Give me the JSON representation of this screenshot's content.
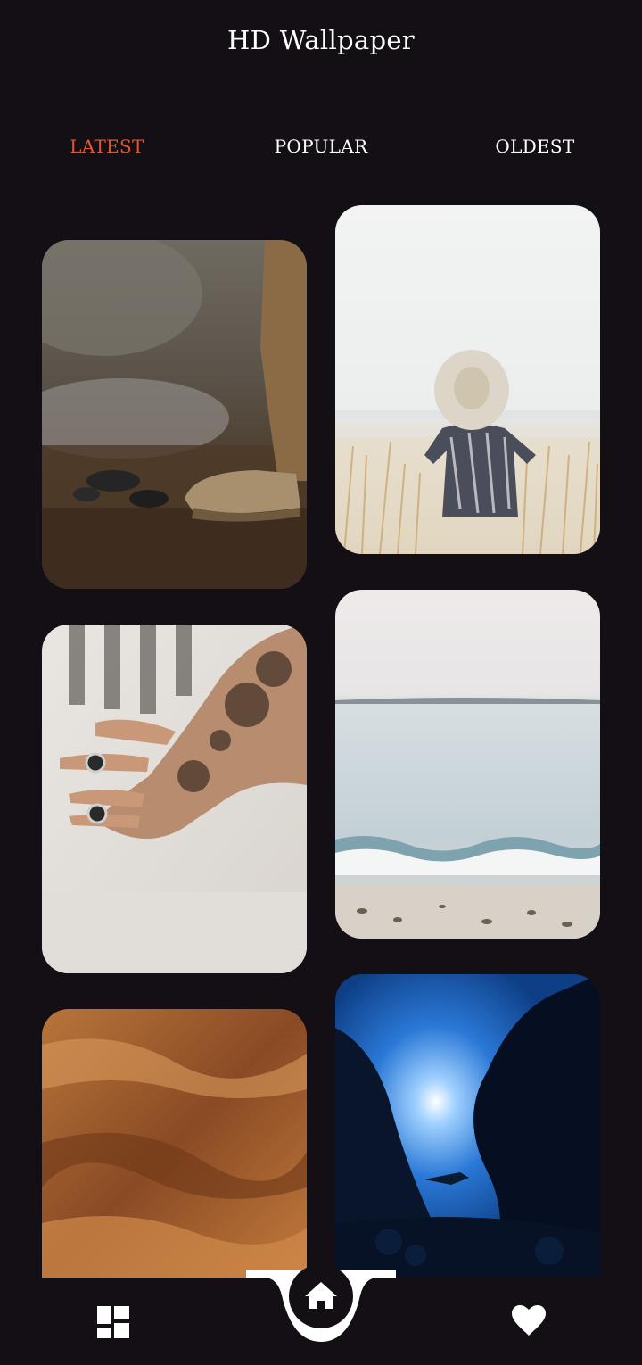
{
  "header": {
    "title": "HD Wallpaper"
  },
  "tabs": [
    {
      "label": "LATEST",
      "active": true
    },
    {
      "label": "POPULAR",
      "active": false
    },
    {
      "label": "OLDEST",
      "active": false
    }
  ],
  "colors": {
    "background": "#140f14",
    "accent": "#e4572e",
    "text": "#ffffff"
  },
  "wallpapers": [
    {
      "subject": "boot-on-rocks"
    },
    {
      "subject": "woman-straw-hat-beach"
    },
    {
      "subject": "tattooed-hand-rings"
    },
    {
      "subject": "calm-sea-shore"
    },
    {
      "subject": "orange-sand-texture"
    },
    {
      "subject": "underwater-cave-diver"
    }
  ],
  "bottom_nav": {
    "left_icon": "grid-icon",
    "center_icon": "home-icon",
    "right_icon": "heart-icon"
  }
}
